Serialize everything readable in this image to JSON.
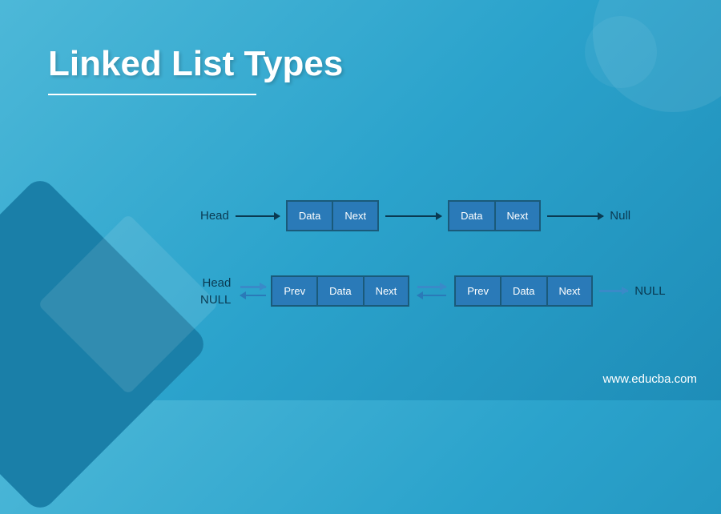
{
  "title": "Linked List Types",
  "watermark": "www.educba.com",
  "singly": {
    "head": "Head",
    "node1": {
      "data": "Data",
      "next": "Next"
    },
    "node2": {
      "data": "Data",
      "next": "Next"
    },
    "null": "Null"
  },
  "doubly": {
    "head": "Head",
    "null_left": "NULL",
    "node1": {
      "prev": "Prev",
      "data": "Data",
      "next": "Next"
    },
    "node2": {
      "prev": "Prev",
      "data": "Data",
      "next": "Next"
    },
    "null_right": "NULL"
  }
}
